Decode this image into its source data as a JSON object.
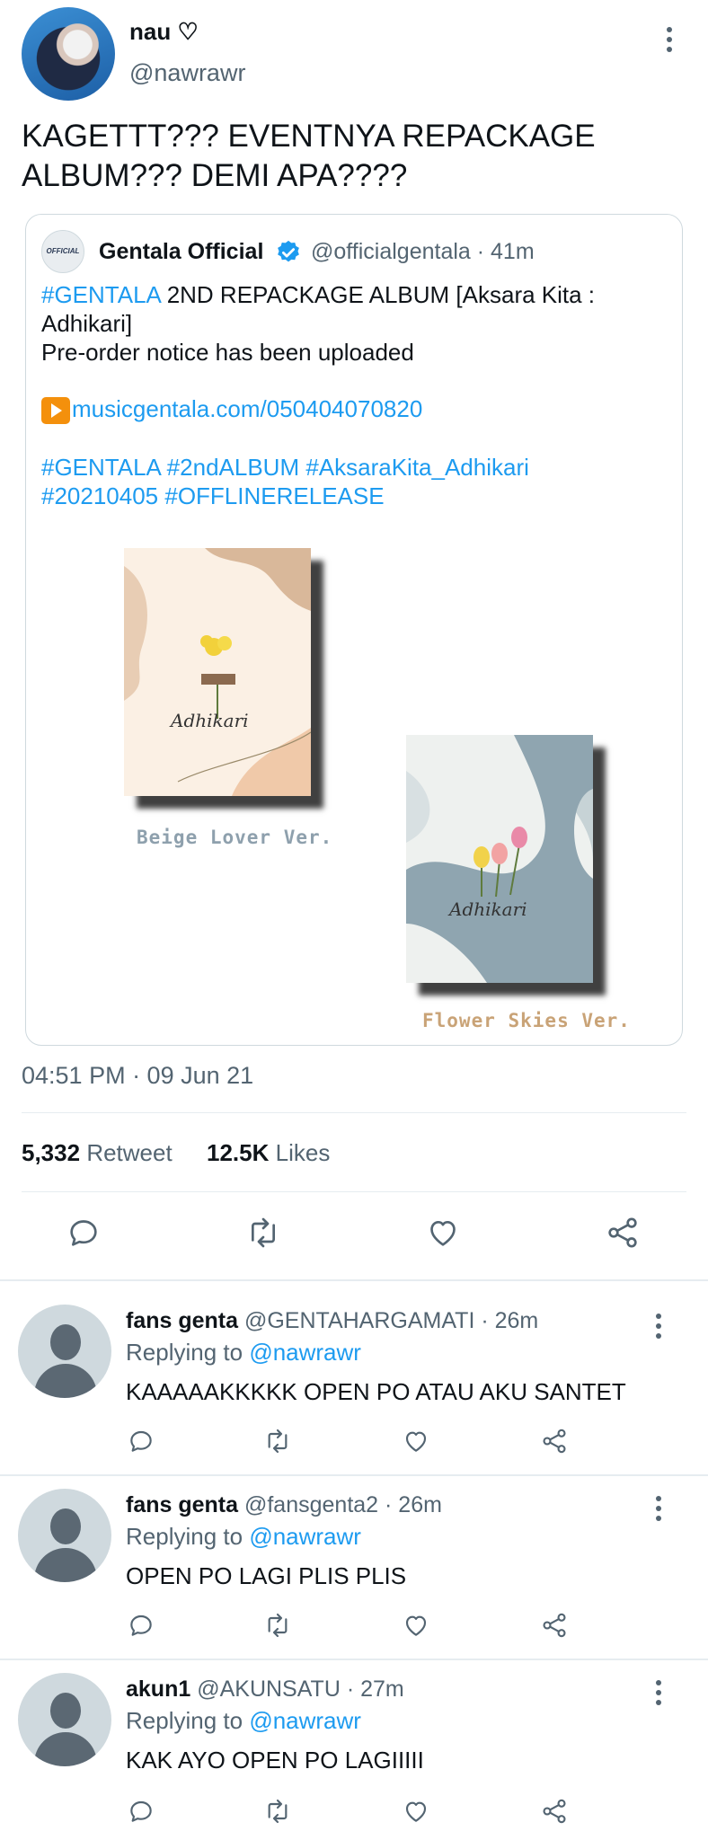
{
  "tweet": {
    "display_name": "nau ♡",
    "handle": "@nawrawr",
    "text_line1": "KAGETTT??? EVENTNYA REPACKAGE",
    "text_line2": "ALBUM??? DEMI APA????",
    "timestamp": "04:51 PM · 09 Jun 21",
    "retweet_count": "5,332",
    "retweet_label": "Retweet",
    "like_count": "12.5K",
    "like_label": "Likes"
  },
  "quoted": {
    "display_name": "Gentala Official",
    "avatar_text": "OFFICIAL",
    "handle_time": "@officialgentala · 41m",
    "hashtag1": "#GENTALA",
    "line1_rest": " 2ND REPACKAGE ALBUM [Aksara Kita :",
    "line2": "Adhikari]",
    "line3": "Pre-order notice has been uploaded",
    "link": "musicgentala.com/050404070820",
    "tags_line1": "#GENTALA #2ndALBUM #AksaraKita_Adhikari",
    "tags_line2": "#20210405 #OFFLINERELEASE",
    "album1_caption": "Beige Lover Ver.",
    "album2_caption": "Flower Skies Ver.",
    "album_script": "Adhikari"
  },
  "replies": [
    {
      "name": "fans genta",
      "handle_time": "@GENTAHARGAMATI · 26m",
      "replying_label": "Replying to",
      "replying_to": "@nawrawr",
      "text": "KAAAAAKKKKK OPEN PO ATAU AKU SANTET"
    },
    {
      "name": "fans genta",
      "handle_time": "@fansgenta2 · 26m",
      "replying_label": "Replying to",
      "replying_to": "@nawrawr",
      "text": "OPEN PO LAGI PLIS PLIS"
    },
    {
      "name": "akun1",
      "handle_time": "@AKUNSATU · 27m",
      "replying_label": "Replying to",
      "replying_to": "@nawrawr",
      "text": "KAK AYO OPEN PO LAGIIIII"
    }
  ],
  "icons": {
    "reply": "reply-icon",
    "retweet": "retweet-icon",
    "like": "heart-icon",
    "share": "share-icon",
    "more": "more-vertical-icon",
    "verified": "verified-badge-icon",
    "play": "play-button-icon"
  },
  "colors": {
    "accent": "#1d9bf0",
    "secondary_text": "#536471",
    "beige_caption": "#8ea0ad",
    "flower_caption": "#c9a377"
  }
}
